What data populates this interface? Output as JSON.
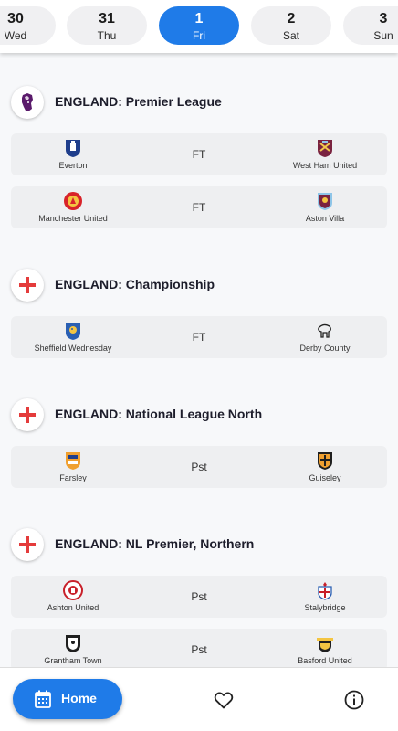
{
  "dates": [
    {
      "num": "30",
      "day": "Wed",
      "active": false
    },
    {
      "num": "31",
      "day": "Thu",
      "active": false
    },
    {
      "num": "1",
      "day": "Fri",
      "active": true
    },
    {
      "num": "2",
      "day": "Sat",
      "active": false
    },
    {
      "num": "3",
      "day": "Sun",
      "active": false
    }
  ],
  "leagues": [
    {
      "name": "ENGLAND: Premier League",
      "icon": "premier-league-lion-icon",
      "matches": [
        {
          "home": "Everton",
          "status": "FT",
          "away": "West Ham United",
          "home_icon": "everton-crest-icon",
          "away_icon": "west-ham-crest-icon"
        },
        {
          "home": "Manchester United",
          "status": "FT",
          "away": "Aston Villa",
          "home_icon": "man-united-crest-icon",
          "away_icon": "aston-villa-crest-icon"
        }
      ]
    },
    {
      "name": "ENGLAND: Championship",
      "icon": "england-flag-icon",
      "matches": [
        {
          "home": "Sheffield Wednesday",
          "status": "FT",
          "away": "Derby County",
          "home_icon": "sheffield-wednesday-crest-icon",
          "away_icon": "derby-county-crest-icon"
        }
      ]
    },
    {
      "name": "ENGLAND: National League North",
      "icon": "england-flag-icon",
      "matches": [
        {
          "home": "Farsley",
          "status": "Pst",
          "away": "Guiseley",
          "home_icon": "farsley-crest-icon",
          "away_icon": "guiseley-crest-icon"
        }
      ]
    },
    {
      "name": "ENGLAND: NL Premier, Northern",
      "icon": "england-flag-icon",
      "matches": [
        {
          "home": "Ashton United",
          "status": "Pst",
          "away": "Stalybridge",
          "home_icon": "ashton-united-crest-icon",
          "away_icon": "stalybridge-crest-icon"
        },
        {
          "home": "Grantham Town",
          "status": "Pst",
          "away": "Basford United",
          "home_icon": "grantham-town-crest-icon",
          "away_icon": "basford-united-crest-icon"
        }
      ]
    }
  ],
  "bottom_nav": {
    "home_label": "Home",
    "home_icon": "calendar-icon",
    "favorites_icon": "heart-icon",
    "info_icon": "info-icon"
  },
  "colors": {
    "accent": "#1f7be8",
    "card_bg": "#eeeff1",
    "page_bg": "#f7f8fa",
    "premier_league_purple": "#5a1a6b",
    "england_red": "#e43b3b"
  }
}
